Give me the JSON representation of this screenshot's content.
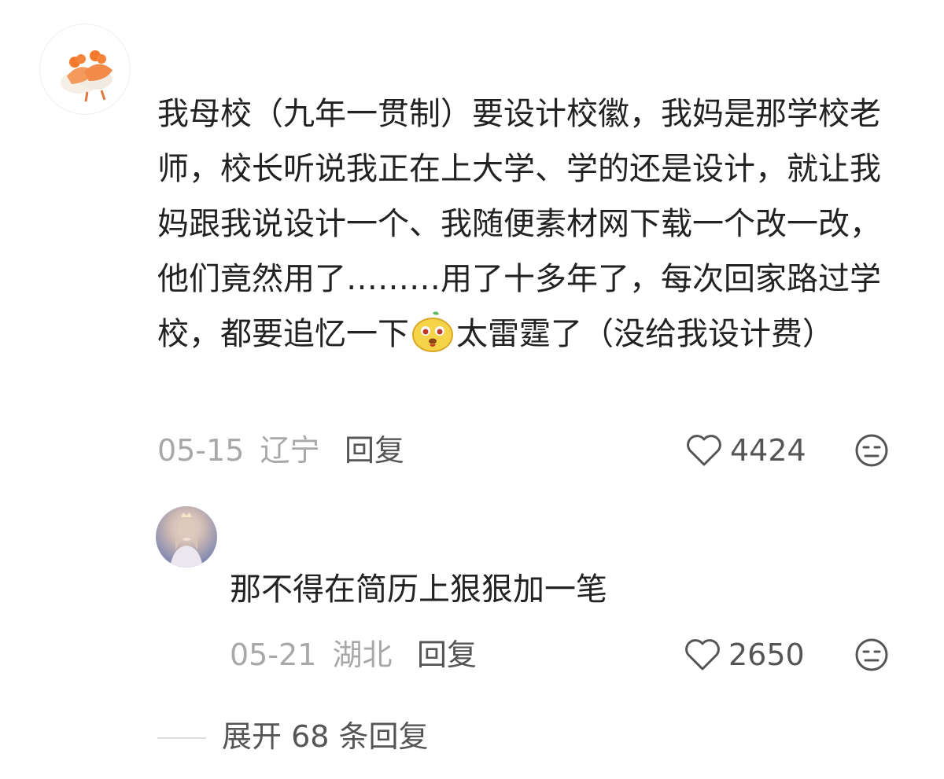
{
  "comment": {
    "text_before_emoji": "我母校（九年一贯制）要设计校徽，我妈是那学校老师，校长听说我正在上大学、学的还是设计，就让我妈跟我说设计一个、我随便素材网下载一个改一改，他们竟然用了………用了十多年了，每次回家路过学校，都要追忆一下",
    "text_after_emoji": "太雷霆了（没给我设计费）",
    "emoji_icon": "yellow-face-emoji",
    "date": "05-15",
    "location": "辽宁",
    "reply_label": "回复",
    "likes": "4424"
  },
  "reply": {
    "text": "那不得在简历上狠狠加一笔",
    "date": "05-21",
    "location": "湖北",
    "reply_label": "回复",
    "likes": "2650"
  },
  "expand_label": "展开 68 条回复",
  "colors": {
    "text_primary": "#222222",
    "text_meta": "#a8a8a8",
    "text_action": "#555555"
  }
}
